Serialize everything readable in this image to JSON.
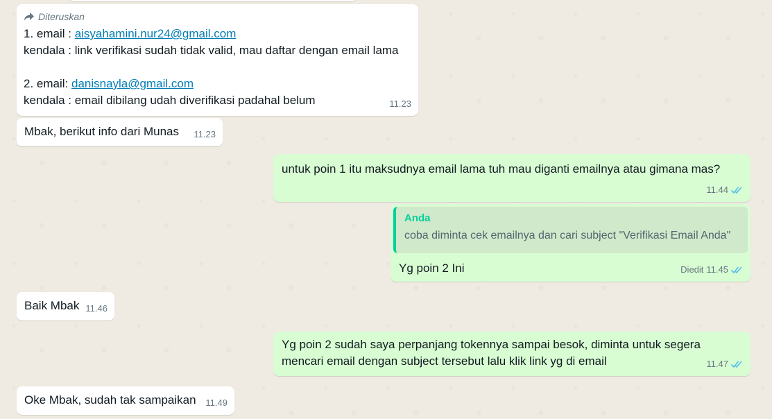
{
  "messages": {
    "m1": {
      "forwarded_label": "Diteruskan",
      "line1_prefix": "1. email : ",
      "line1_email": "aisyahamini.nur24@gmail.com",
      "line2": "kendala : link verifikasi sudah tidak valid, mau daftar dengan email lama",
      "line3_prefix": "2. email: ",
      "line3_email": "danisnayla@gmail.com",
      "line4": "kendala : email dibilang udah diverifikasi padahal belum",
      "time": "11.23"
    },
    "m2": {
      "text": "Mbak, berikut info dari Munas",
      "time": "11.23"
    },
    "m3": {
      "text": "untuk poin 1 itu maksudnya email lama tuh mau diganti emailnya atau gimana mas?",
      "time": "11.44"
    },
    "m4": {
      "quote_author": "Anda",
      "quote_text": "coba diminta cek emailnya dan cari subject \"Verifikasi Email Anda\"",
      "text": "Yg poin 2 Ini",
      "edited_label": "Diedit",
      "time": "11.45"
    },
    "m5": {
      "text": "Baik Mbak",
      "time": "11.46"
    },
    "m6": {
      "line1": "Yg poin 2 sudah saya perpanjang tokennya sampai besok, diminta untuk segera",
      "line2": "mencari email dengan subject tersebut lalu klik link yg di email",
      "time": "11.47"
    },
    "m7": {
      "text": "Oke Mbak, sudah tak sampaikan",
      "time": "11.49"
    }
  },
  "colors": {
    "background": "#efeae2",
    "incoming_bubble": "#ffffff",
    "outgoing_bubble": "#d9fdd3",
    "read_ticks": "#53bdeb",
    "link": "#027eb5",
    "quote_author": "#06cf9c"
  },
  "icons": {
    "forward": "forward-arrow-icon",
    "read": "double-check-icon"
  }
}
